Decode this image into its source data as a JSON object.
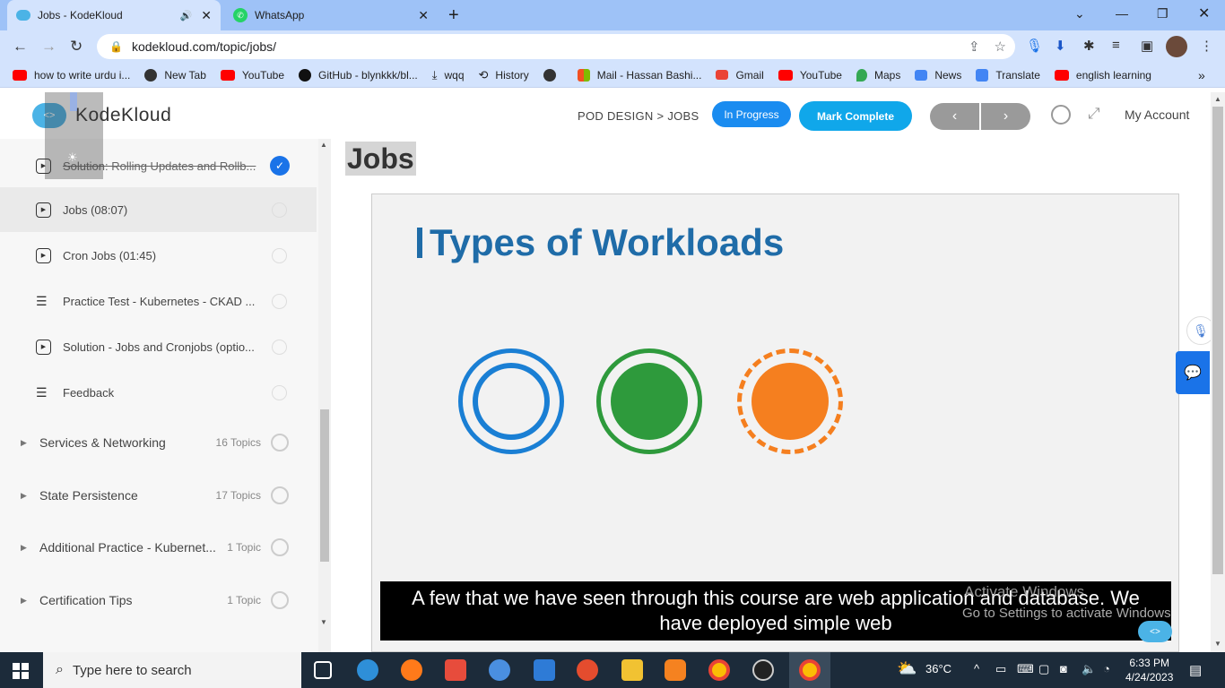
{
  "browser": {
    "tabs": [
      {
        "title": "Jobs - KodeKloud",
        "active": true
      },
      {
        "title": "WhatsApp",
        "active": false
      }
    ],
    "url": "kodekloud.com/topic/jobs/",
    "bookmarks": [
      {
        "label": "how to write urdu i...",
        "icon": "youtube-icon"
      },
      {
        "label": "New Tab",
        "icon": "globe-icon"
      },
      {
        "label": "YouTube",
        "icon": "youtube-icon"
      },
      {
        "label": "GitHub - blynkkk/bl...",
        "icon": "github-icon"
      },
      {
        "label": "wqq",
        "icon": "download-icon"
      },
      {
        "label": "History",
        "icon": "history-icon"
      },
      {
        "label": "",
        "icon": "globe-icon"
      },
      {
        "label": "Mail - Hassan Bashi...",
        "icon": "microsoft-icon"
      },
      {
        "label": "Gmail",
        "icon": "gmail-icon"
      },
      {
        "label": "YouTube",
        "icon": "youtube-icon"
      },
      {
        "label": "Maps",
        "icon": "maps-icon"
      },
      {
        "label": "News",
        "icon": "news-icon"
      },
      {
        "label": "Translate",
        "icon": "translate-icon"
      },
      {
        "label": "english learning",
        "icon": "youtube-icon"
      }
    ]
  },
  "header": {
    "logo_text": "KodeKloud",
    "breadcrumb": "POD DESIGN > JOBS",
    "status_button": "In Progress",
    "complete_button": "Mark Complete",
    "prev_glyph": "‹",
    "next_glyph": "›",
    "account": "My Account"
  },
  "sidebar": {
    "lessons": [
      {
        "label": "Solution: Rolling Updates and Rollb...",
        "type": "video",
        "done": true
      },
      {
        "label": "Jobs (08:07)",
        "type": "video",
        "current": true
      },
      {
        "label": "Cron Jobs (01:45)",
        "type": "video"
      },
      {
        "label": "Practice Test - Kubernetes - CKAD ...",
        "type": "doc"
      },
      {
        "label": "Solution - Jobs and Cronjobs (optio...",
        "type": "video"
      },
      {
        "label": "Feedback",
        "type": "doc"
      }
    ],
    "sections": [
      {
        "label": "Services & Networking",
        "count": "16 Topics"
      },
      {
        "label": "State Persistence",
        "count": "17 Topics"
      },
      {
        "label": "Additional Practice - Kubernet...",
        "count": "1 Topic"
      },
      {
        "label": "Certification Tips",
        "count": "1 Topic"
      }
    ]
  },
  "content": {
    "title": "Jobs",
    "slide_title": "Types of Workloads",
    "caption_line1": "A few that we have seen through this course are web application and database. We",
    "caption_line2": "have deployed simple web",
    "watermark_line1": "Activate Windows",
    "watermark_line2": "Go to Settings to activate Windows"
  },
  "taskbar": {
    "search_placeholder": "Type here to search",
    "temperature": "36°C",
    "time": "6:33 PM",
    "date": "4/24/2023"
  }
}
